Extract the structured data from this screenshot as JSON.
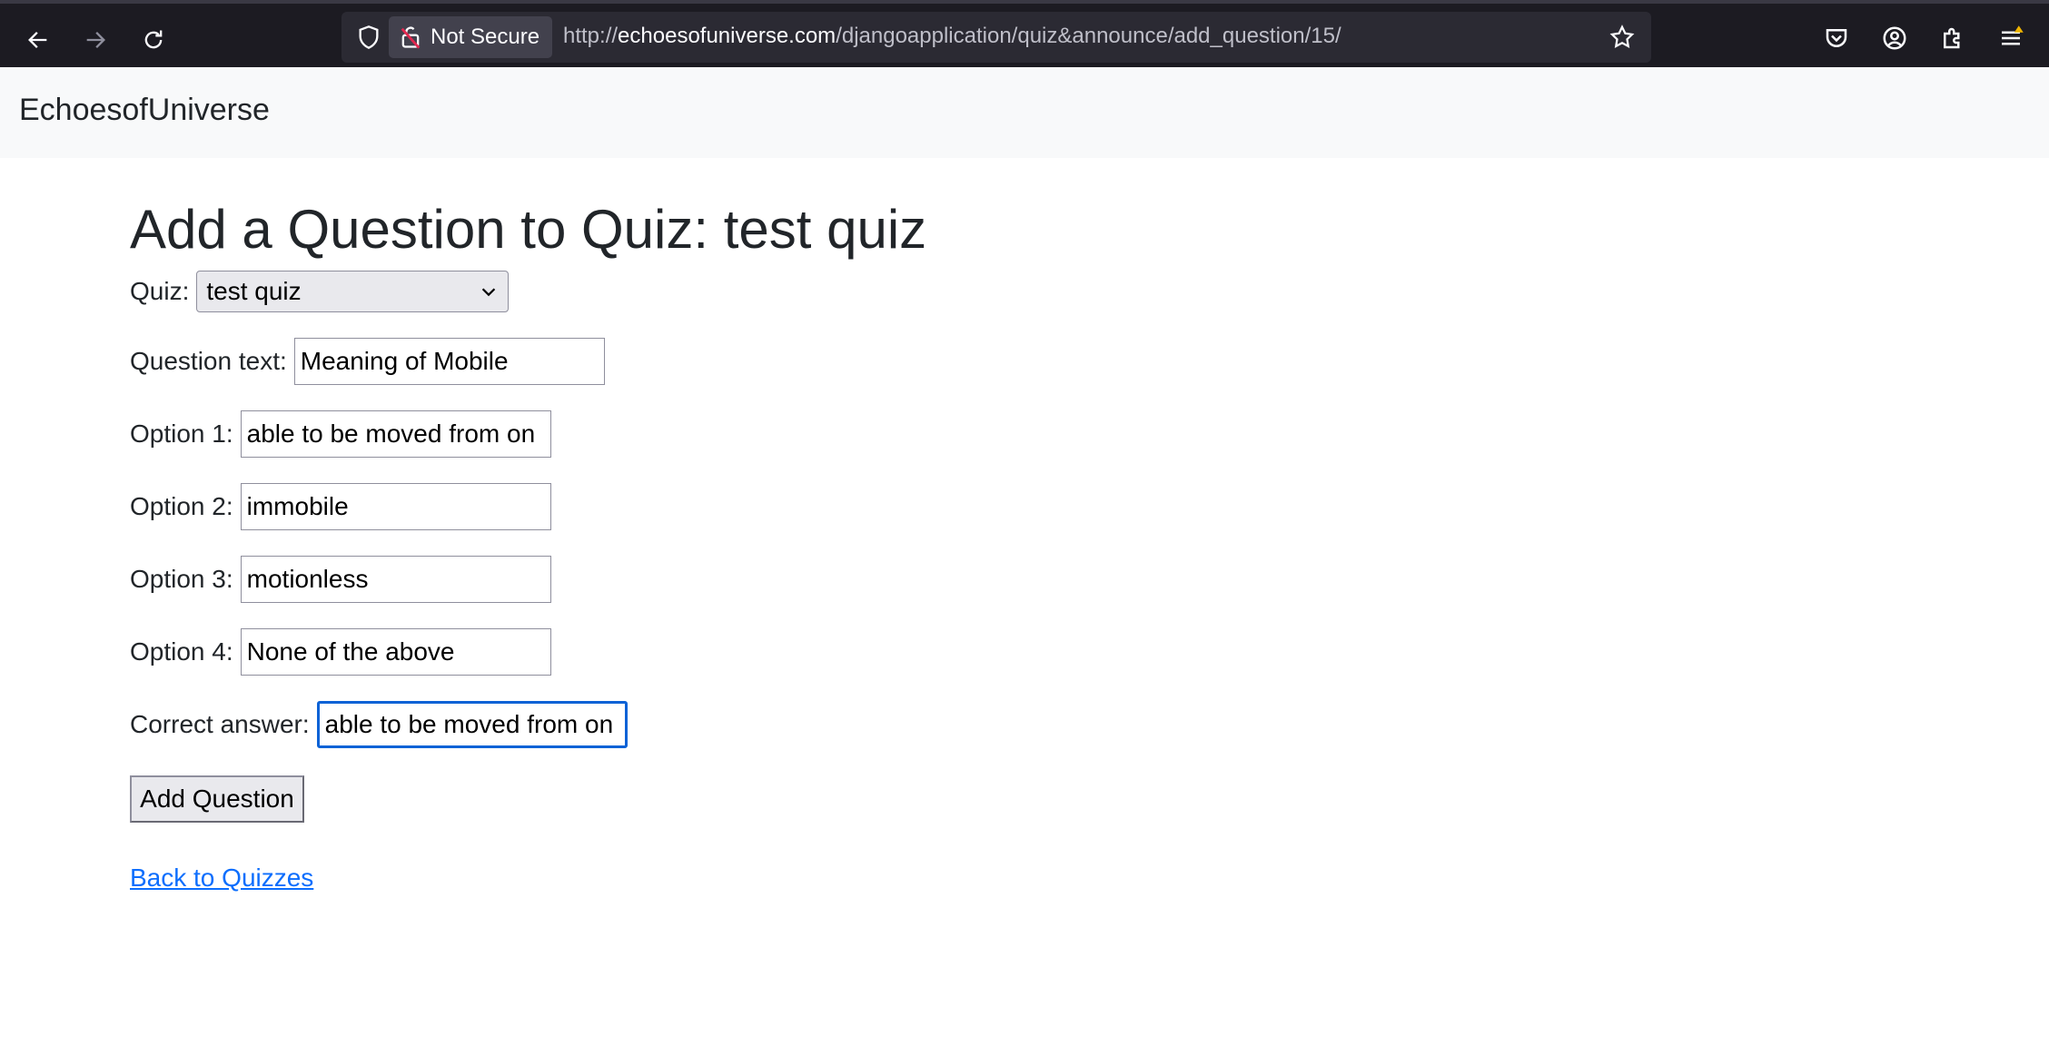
{
  "browser": {
    "security_label": "Not Secure",
    "url_prefix": "http://",
    "url_host": "echoesofuniverse.com",
    "url_path": "/djangoapplication/quiz&announce/add_question/15/",
    "colors": {
      "chrome_bg": "#1c1b22",
      "urlbar_bg": "#2b2a33",
      "warning_badge": "#f0b400"
    }
  },
  "navbar": {
    "brand": "EchoesofUniverse"
  },
  "page": {
    "title": "Add a Question to Quiz: test quiz",
    "form": {
      "quiz_label": "Quiz:",
      "quiz_selected": "test quiz",
      "question_label": "Question text:",
      "question_value": "Meaning of Mobile",
      "option1_label": "Option 1:",
      "option1_value": "able to be moved from on",
      "option2_label": "Option 2:",
      "option2_value": "immobile",
      "option3_label": "Option 3:",
      "option3_value": "motionless",
      "option4_label": "Option 4:",
      "option4_value": "None of the above",
      "correct_label": "Correct answer:",
      "correct_value": "able to be moved from on",
      "submit_label": "Add Question"
    },
    "back_link": "Back to Quizzes",
    "colors": {
      "link": "#0d6efd",
      "focus_ring": "#0b62d6",
      "navbar_bg": "#f8f9fa"
    }
  }
}
